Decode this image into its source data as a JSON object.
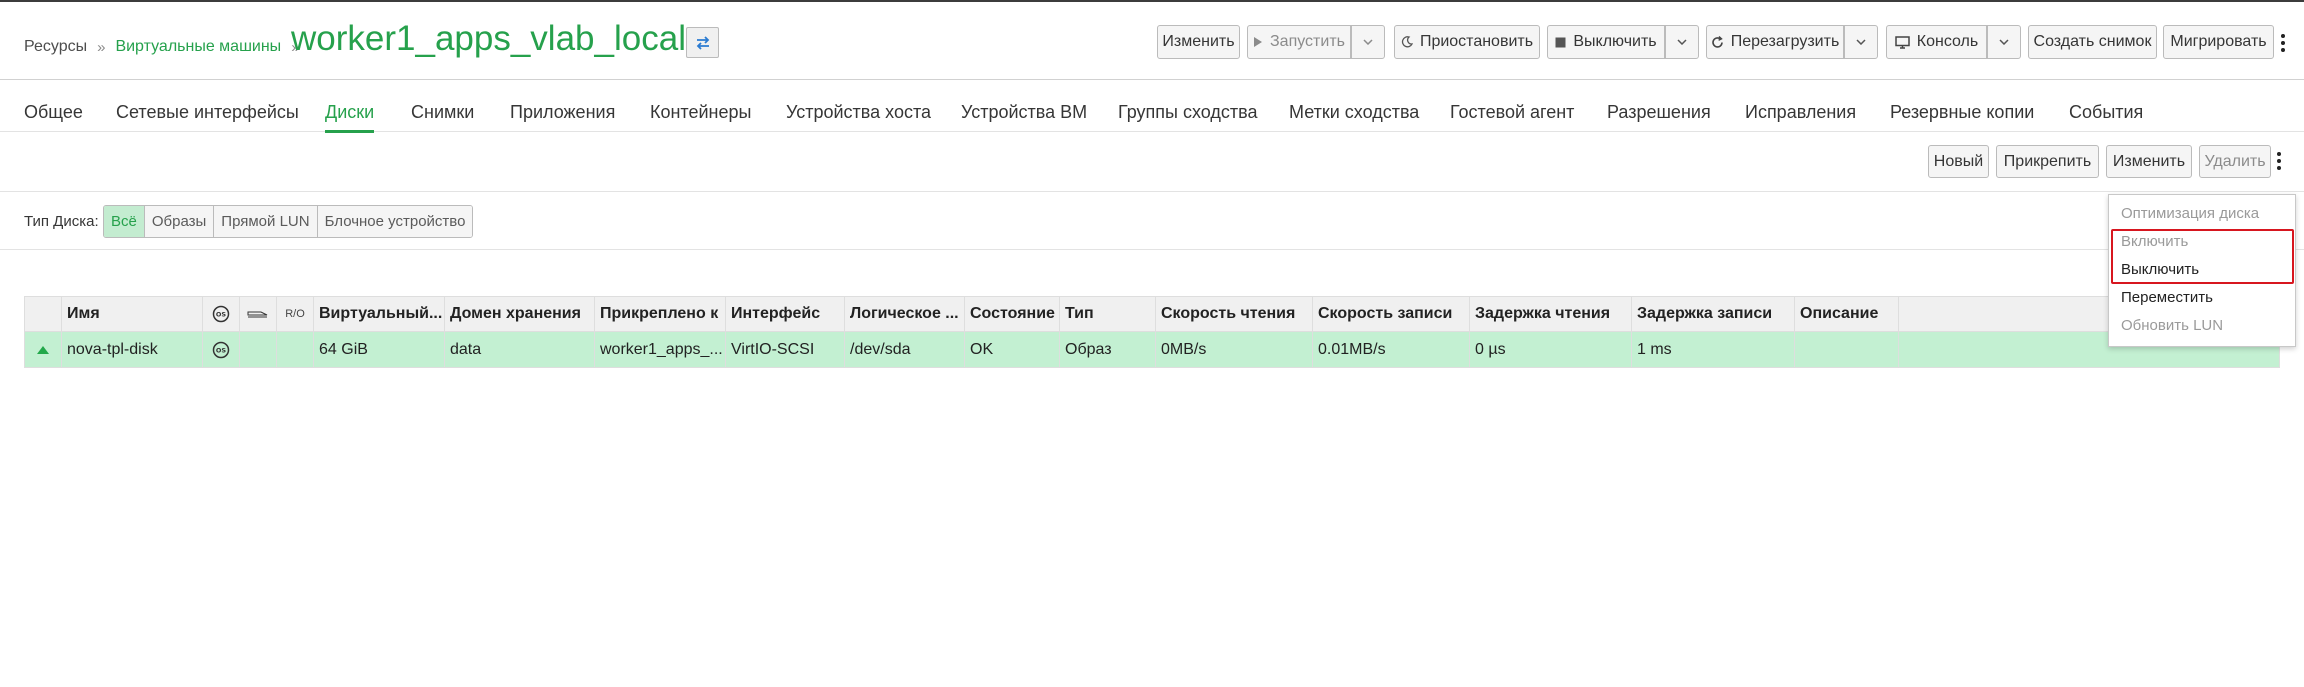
{
  "breadcrumb": {
    "root": "Ресурсы",
    "vms": "Виртуальные машины",
    "vm_name": "worker1_apps_vlab_local"
  },
  "header_actions": {
    "edit": "Изменить",
    "run": "Запустить",
    "suspend": "Приостановить",
    "shutdown": "Выключить",
    "reboot": "Перезагрузить",
    "console": "Консоль",
    "snapshot": "Создать снимок",
    "migrate": "Мигрировать"
  },
  "tabs": [
    {
      "label": "Общее"
    },
    {
      "label": "Сетевые интерфейсы"
    },
    {
      "label": "Диски"
    },
    {
      "label": "Снимки"
    },
    {
      "label": "Приложения"
    },
    {
      "label": "Контейнеры"
    },
    {
      "label": "Устройства хоста"
    },
    {
      "label": "Устройства ВМ"
    },
    {
      "label": "Группы сходства"
    },
    {
      "label": "Метки сходства"
    },
    {
      "label": "Гостевой агент"
    },
    {
      "label": "Разрешения"
    },
    {
      "label": "Исправления"
    },
    {
      "label": "Резервные копии"
    },
    {
      "label": "События"
    }
  ],
  "disk_actions": {
    "new": "Новый",
    "attach": "Прикрепить",
    "edit": "Изменить",
    "remove": "Удалить"
  },
  "filter": {
    "label": "Тип Диска:",
    "options": [
      "Всё",
      "Образы",
      "Прямой LUN",
      "Блочное устройство"
    ]
  },
  "table": {
    "columns": [
      "Имя",
      "OS",
      "R/O",
      "Виртуальный...",
      "Домен хранения",
      "Прикреплено к",
      "Интерфейс",
      "Логическое ...",
      "Состояние",
      "Тип",
      "Скорость чтения",
      "Скорость записи",
      "Задержка чтения",
      "Задержка записи",
      "Описание"
    ],
    "rows": [
      {
        "name": "nova-tpl-disk",
        "size": "64 GiB",
        "domain": "data",
        "attached": "worker1_apps_...",
        "interface": "VirtIO-SCSI",
        "logical": "/dev/sda",
        "status": "OK",
        "type": "Образ",
        "read_rate": "0MB/s",
        "write_rate": "0.01MB/s",
        "read_latency": "0 µs",
        "write_latency": "1 ms",
        "description": ""
      }
    ]
  },
  "menu": {
    "items": [
      "Оптимизация диска",
      "Включить",
      "Выключить",
      "Переместить",
      "Обновить LUN"
    ]
  },
  "colors": {
    "brand": "#26a14c",
    "row_selected": "#c3f0d2",
    "highlight": "#d7161f"
  }
}
